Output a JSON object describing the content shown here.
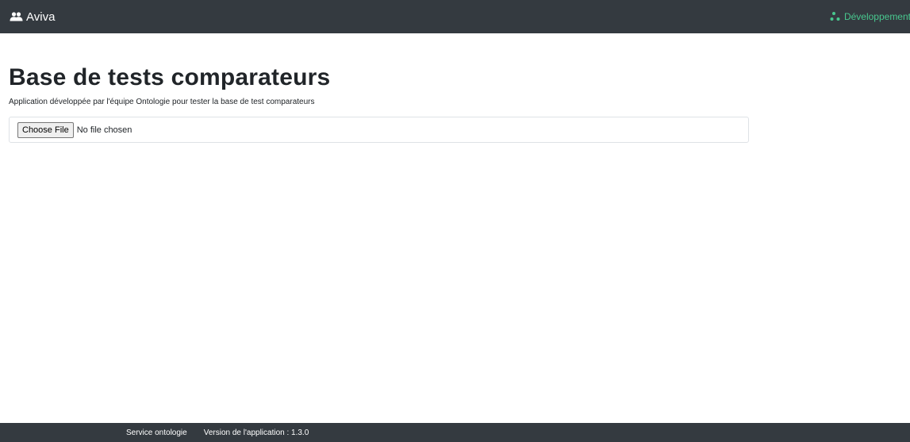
{
  "navbar": {
    "brand_label": "Aviva",
    "brand_icon": "users-icon",
    "environment_label": "Développement",
    "environment_icon": "dots-icon",
    "environment_color": "#48c78e",
    "background_color": "#343a40"
  },
  "main": {
    "title": "Base de tests comparateurs",
    "subtitle": "Application développée par l'équipe Ontologie pour tester la base de test comparateurs",
    "file_input": {
      "button_label": "Choose File",
      "status_text": "No file chosen"
    }
  },
  "footer": {
    "service_label": "Service ontologie",
    "version_label": "Version de l'application : 1.3.0"
  }
}
